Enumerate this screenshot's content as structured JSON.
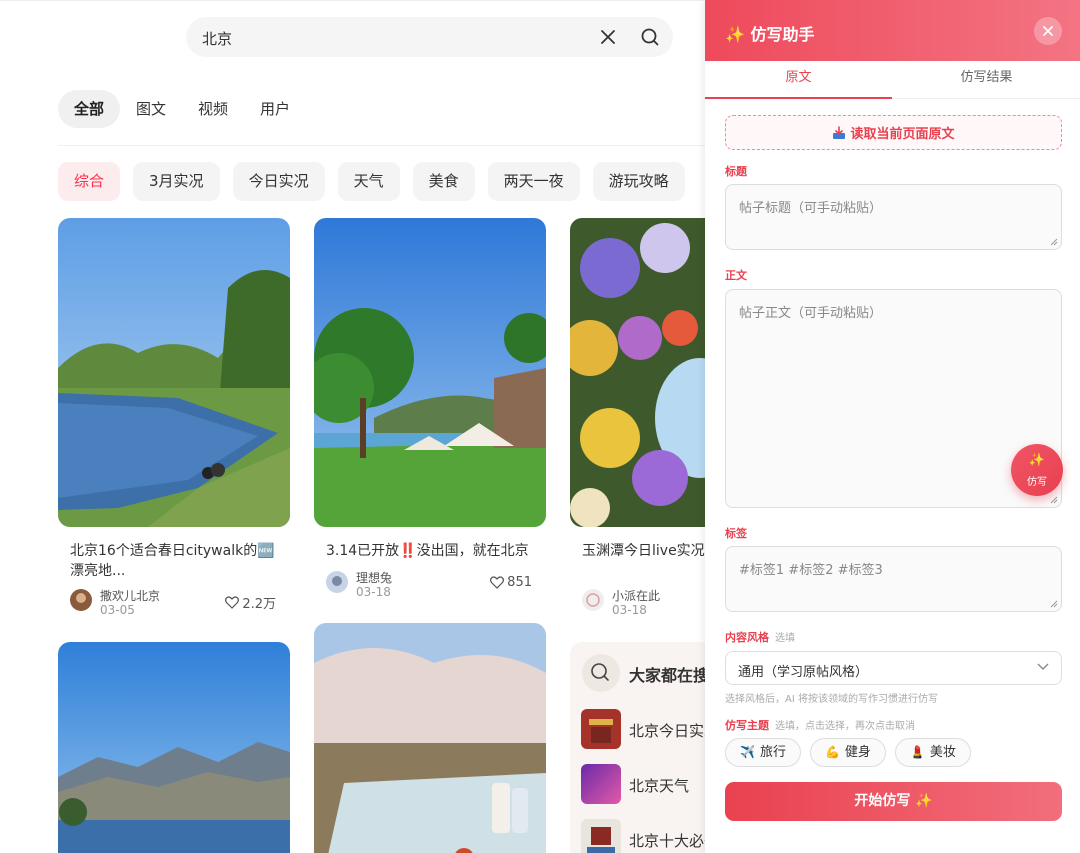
{
  "search": {
    "query": "北京"
  },
  "tabs": [
    {
      "label": "全部",
      "active": true
    },
    {
      "label": "图文"
    },
    {
      "label": "视频"
    },
    {
      "label": "用户"
    }
  ],
  "chips": [
    {
      "label": "综合",
      "active": true
    },
    {
      "label": "3月实况"
    },
    {
      "label": "今日实况"
    },
    {
      "label": "天气"
    },
    {
      "label": "美食"
    },
    {
      "label": "两天一夜"
    },
    {
      "label": "游玩攻略"
    }
  ],
  "cards": [
    {
      "title": "北京16个适合春日citywalk的🆕漂亮地...",
      "author": "撒欢儿北京",
      "date": "03-05",
      "likes": "2.2万"
    },
    {
      "title": "3.14已开放‼️没出国，就在北京",
      "author": "理想兔",
      "date": "03-18",
      "likes": "851"
    },
    {
      "title": "玉渊潭今日live实况🌸像化了...",
      "author": "小派在此",
      "date": "03-18",
      "likes": ""
    }
  ],
  "hot": {
    "title": "大家都在搜",
    "items": [
      {
        "label": "北京今日实况"
      },
      {
        "label": "北京天气"
      },
      {
        "label": "北京十大必去"
      }
    ]
  },
  "panel": {
    "title": "✨ 仿写助手",
    "tabs": [
      {
        "label": "原文",
        "active": true
      },
      {
        "label": "仿写结果"
      }
    ],
    "read_button": "读取当前页面原文",
    "title_label": "标题",
    "title_placeholder": "帖子标题（可手动粘贴）",
    "body_label": "正文",
    "body_placeholder": "帖子正文（可手动粘贴）",
    "fab_star": "✨",
    "fab_label": "仿写",
    "tags_label": "标签",
    "tags_placeholder": "#标签1 #标签2 #标签3",
    "style_label": "内容风格",
    "style_sub": "选填",
    "style_value": "通用（学习原帖风格）",
    "style_hint": "选择风格后，AI 将按该领域的写作习惯进行仿写",
    "topic_label": "仿写主题",
    "topic_sub": "选填，点击选择，再次点击取消",
    "topics": [
      {
        "icon": "✈️",
        "label": "旅行"
      },
      {
        "icon": "💪",
        "label": "健身"
      },
      {
        "icon": "💄",
        "label": "美妆"
      }
    ],
    "start_button": "开始仿写 ✨"
  },
  "colors": {
    "accent": "#e9414f",
    "chip_active": "#ff2e4d"
  }
}
